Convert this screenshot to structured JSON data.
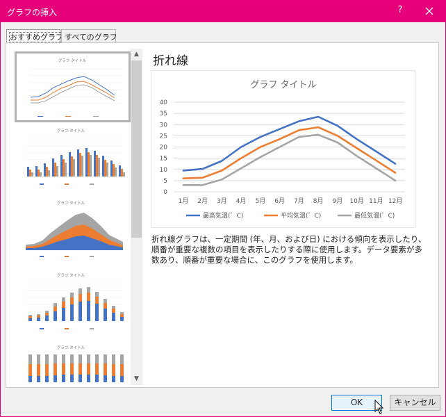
{
  "window": {
    "title": "グラフの挿入",
    "help_label": "?"
  },
  "tabs": [
    {
      "label": "おすすめグラフ",
      "active": true
    },
    {
      "label": "すべてのグラフ",
      "active": false
    }
  ],
  "thumbnails": [
    {
      "type": "line",
      "title": "グラフ タイトル",
      "selected": true
    },
    {
      "type": "clustered-column",
      "title": "グラフ タイトル",
      "selected": false
    },
    {
      "type": "stacked-area",
      "title": "グラフ タイトル",
      "selected": false
    },
    {
      "type": "stacked-column",
      "title": "グラフ タイトル",
      "selected": false
    },
    {
      "type": "100-percent-stacked-column",
      "title": "グラフ タイトル",
      "selected": false
    }
  ],
  "preview": {
    "heading": "折れ線",
    "description": "折れ線グラフは、一定期間 (年、月、および日) における傾向を表示したり、順番が重要な複数の項目を表示したりする際に使用します。データ要素が多数あり、順番が重要な場合に、このグラフを使用します。"
  },
  "chart_data": {
    "type": "line",
    "title": "グラフ タイトル",
    "categories": [
      "1月",
      "2月",
      "3月",
      "4月",
      "5月",
      "6月",
      "7月",
      "8月",
      "9月",
      "10月",
      "11月",
      "12月"
    ],
    "series": [
      {
        "name": "最高気温(゜C)",
        "color": "#4472c4",
        "values": [
          9.5,
          10.2,
          13.8,
          20,
          24.5,
          28,
          31.5,
          33.5,
          29.5,
          23.5,
          18,
          12.5
        ]
      },
      {
        "name": "平均気温(゜C)",
        "color": "#ed7d31",
        "values": [
          6,
          6.3,
          9.5,
          15,
          20,
          23.5,
          27.5,
          28.8,
          25,
          19.5,
          14,
          8.5
        ]
      },
      {
        "name": "最低気温(゜C)",
        "color": "#a5a5a5",
        "values": [
          3,
          3,
          5.5,
          10.5,
          15.5,
          20,
          24.5,
          25.5,
          22,
          16,
          10.5,
          5
        ]
      }
    ],
    "ylim": [
      0,
      40
    ],
    "yticks": [
      0,
      5,
      10,
      15,
      20,
      25,
      30,
      35,
      40
    ],
    "grid": true,
    "legend": "bottom"
  },
  "buttons": {
    "ok_label": "OK",
    "cancel_label": "キャンセル"
  },
  "icons": {
    "close": "close-icon",
    "scroll_up": "chevron-up-icon",
    "scroll_down": "chevron-down-icon",
    "cursor": "mouse-pointer-icon"
  }
}
